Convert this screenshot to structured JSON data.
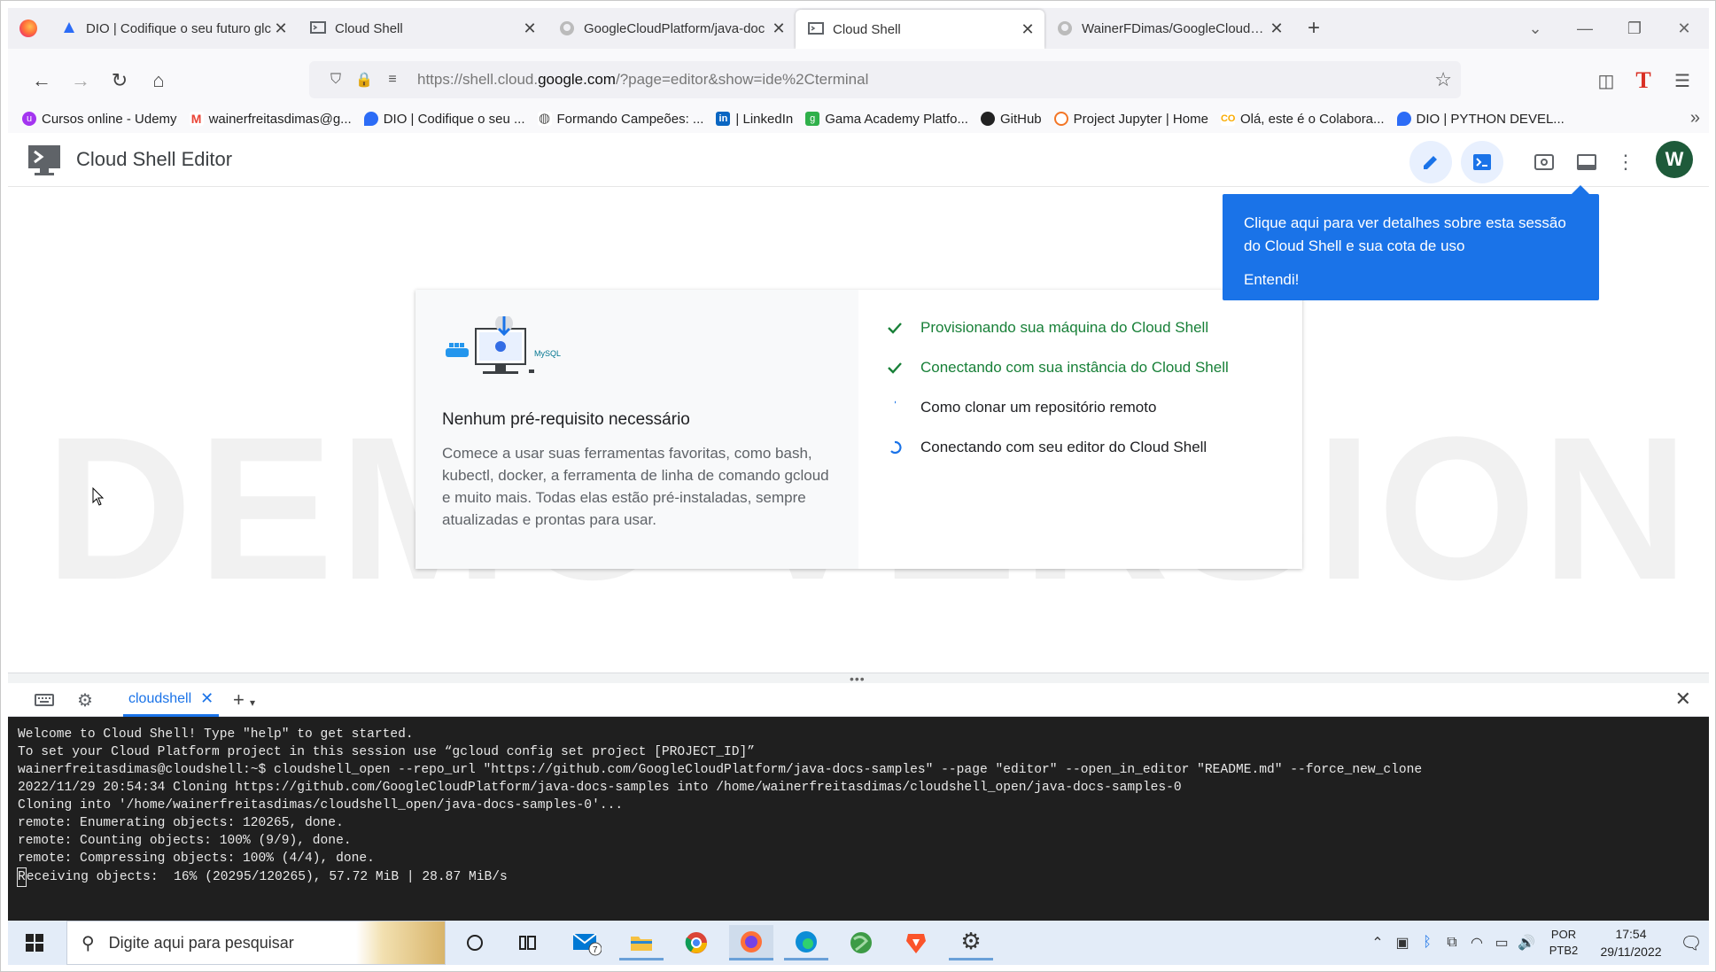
{
  "browser": {
    "tabs": [
      {
        "title": "DIO | Codifique o seu futuro glc",
        "icon": "dio-icon",
        "active": false
      },
      {
        "title": "Cloud Shell",
        "icon": "cloud-shell-icon",
        "active": false
      },
      {
        "title": "GoogleCloudPlatform/java-doc",
        "icon": "github-icon",
        "active": false
      },
      {
        "title": "Cloud Shell",
        "icon": "cloud-shell-icon",
        "active": true
      },
      {
        "title": "WainerFDimas/GoogleCloudPla",
        "icon": "github-icon",
        "active": false
      }
    ],
    "url_prefix": "https://shell.cloud.",
    "url_domain": "google.com",
    "url_suffix": "/?page=editor&show=ide%2Cterminal",
    "bookmarks": [
      {
        "label": "Cursos online - Udemy",
        "icon": "udemy-icon",
        "color": "#a435f0"
      },
      {
        "label": "wainerfreitasdimas@g...",
        "icon": "gmail-icon",
        "color": "#ea4335"
      },
      {
        "label": "DIO | Codifique o seu ...",
        "icon": "dio-icon",
        "color": "#2c6cf6"
      },
      {
        "label": "Formando Campeões: ...",
        "icon": "globe-icon",
        "color": "#555555"
      },
      {
        "label": "| LinkedIn",
        "icon": "linkedin-icon",
        "color": "#0a66c2"
      },
      {
        "label": "Gama Academy Platfo...",
        "icon": "gama-icon",
        "color": "#2fb04a"
      },
      {
        "label": "GitHub",
        "icon": "github-icon",
        "color": "#222222"
      },
      {
        "label": "Project Jupyter | Home",
        "icon": "jupyter-icon",
        "color": "#f37626"
      },
      {
        "label": "Olá, este é o Colabora...",
        "icon": "colab-icon",
        "color": "#f9ab00"
      },
      {
        "label": "DIO | PYTHON DEVEL...",
        "icon": "dio-icon",
        "color": "#2c6cf6"
      }
    ]
  },
  "app": {
    "title": "Cloud Shell Editor",
    "avatar_letter": "W",
    "tooltip": {
      "text": "Clique aqui para ver detalhes sobre esta sessão do Cloud Shell e sua cota de uso",
      "action": "Entendi!"
    },
    "watermark": "DEMO VERSION",
    "card": {
      "heading": "Nenhum pré-requisito necessário",
      "body": "Comece a usar suas ferramentas favoritas, como bash, kubectl, docker, a ferramenta de linha de comando gcloud e muito mais. Todas elas estão pré-instaladas, sempre atualizadas e prontas para usar.",
      "art_label": "MySQL",
      "steps": [
        {
          "label": "Provisionando sua máquina do Cloud Shell",
          "status": "done"
        },
        {
          "label": "Conectando com sua instância do Cloud Shell",
          "status": "done"
        },
        {
          "label": "Como clonar um repositório remoto",
          "status": "loading"
        },
        {
          "label": "Conectando com seu editor do Cloud Shell",
          "status": "loading"
        }
      ]
    }
  },
  "terminal": {
    "tab_label": "cloudshell",
    "lines": [
      "Welcome to Cloud Shell! Type \"help\" to get started.",
      "To set your Cloud Platform project in this session use “gcloud config set project [PROJECT_ID]”",
      "wainerfreitasdimas@cloudshell:~$ cloudshell_open --repo_url \"https://github.com/GoogleCloudPlatform/java-docs-samples\" --page \"editor\" --open_in_editor \"README.md\" --force_new_clone",
      "2022/11/29 20:54:34 Cloning https://github.com/GoogleCloudPlatform/java-docs-samples into /home/wainerfreitasdimas/cloudshell_open/java-docs-samples-0",
      "Cloning into '/home/wainerfreitasdimas/cloudshell_open/java-docs-samples-0'...",
      "remote: Enumerating objects: 120265, done.",
      "remote: Counting objects: 100% (9/9), done.",
      "remote: Compressing objects: 100% (4/4), done."
    ],
    "last_line_cursor_char": "R",
    "last_line_rest": "eceiving objects:  16% (20295/120265), 57.72 MiB | 28.87 MiB/s"
  },
  "taskbar": {
    "search_placeholder": "Digite aqui para pesquisar",
    "mail_badge": "7",
    "lang_line1": "POR",
    "lang_line2": "PTB2",
    "time": "17:54",
    "date": "29/11/2022"
  }
}
